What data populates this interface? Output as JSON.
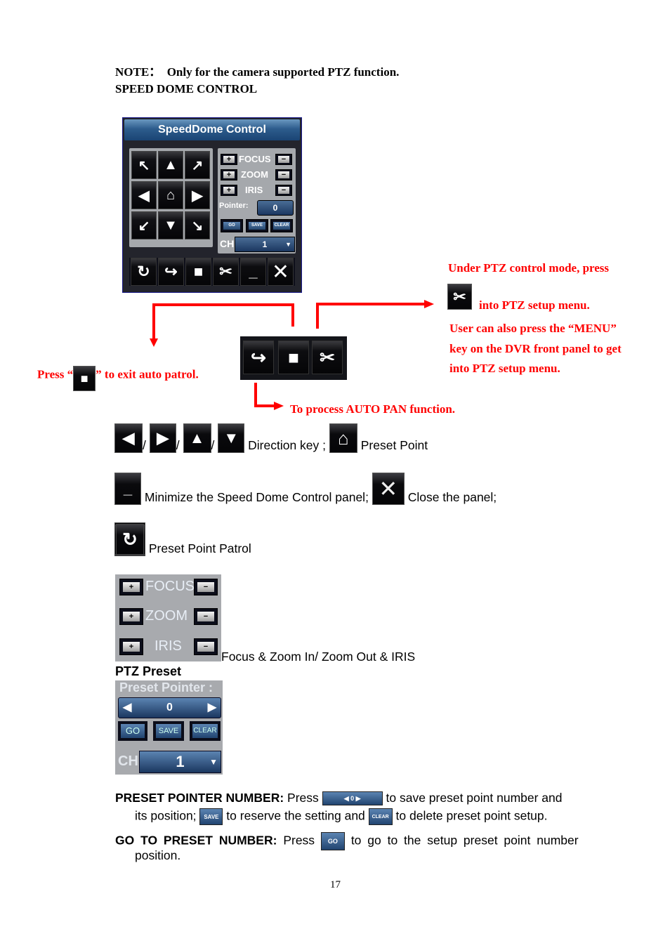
{
  "note": {
    "prefix": "NOTE：",
    "text": "Only for the camera supported PTZ function."
  },
  "heading": "SPEED DOME CONTROL",
  "panel": {
    "title": "SpeedDome Control",
    "direction_icons": [
      "arrow-up-left",
      "arrow-up",
      "arrow-up-right",
      "arrow-left",
      "home",
      "arrow-right",
      "arrow-down-left",
      "arrow-down",
      "arrow-down-right"
    ],
    "adjust_rows": [
      {
        "label": "FOCUS",
        "plus": "+",
        "minus": "−"
      },
      {
        "label": "ZOOM",
        "plus": "+",
        "minus": "−"
      },
      {
        "label": "IRIS",
        "plus": "+",
        "minus": "−"
      }
    ],
    "pointer_label": "Pointer:",
    "pointer_value": "0",
    "buttons": {
      "go": "GO",
      "save": "SAVE",
      "clear": "CLEAR"
    },
    "ch_label": "CH",
    "ch_value": "1",
    "toolbar_icons": [
      "patrol",
      "auto-pan",
      "stop",
      "setup",
      "minimize",
      "close"
    ]
  },
  "callouts": {
    "setup_line1": "Under PTZ control mode, press",
    "setup_line2": "into PTZ setup menu.",
    "menu_line1": "User can also press the “MENU”",
    "menu_line2": "key on the DVR front panel to get",
    "menu_line3": "into PTZ setup menu.",
    "exit_prefix": "Press “",
    "exit_suffix": "” to exit auto patrol.",
    "autopan": "To process AUTO PAN function."
  },
  "legend": {
    "slash": "/",
    "direction_key": "Direction key ;",
    "preset_point": "Preset Point",
    "minimize": "Minimize the Speed Dome Control panel;",
    "close": "Close the panel;",
    "patrol": "Preset Point Patrol",
    "focus_zoom_iris": "Focus & Zoom In/ Zoom Out & IRIS"
  },
  "ptz_preset": {
    "title": "PTZ Preset",
    "pointer_label": "Preset Pointer :",
    "pointer_value": "0",
    "go": "GO",
    "save": "SAVE",
    "clear": "CLEAR",
    "ch_label": "CH",
    "ch_value": "1"
  },
  "descriptions": {
    "ppn_label": "PRESET POINTER NUMBER:",
    "ppn_press": "Press",
    "ppn_text1": "to save preset point number and",
    "ppn_text2": "its position;",
    "ppn_text3": "to reserve the setting and",
    "ppn_text4": "to delete preset point setup.",
    "go_label": "GO TO PRESET NUMBER:",
    "go_press": "Press",
    "go_text1": "to go to the setup preset point number",
    "go_text2": "position."
  },
  "page_number": "17",
  "colors": {
    "annotation": "#ff0000",
    "panel_title": "#2d5c8c"
  }
}
